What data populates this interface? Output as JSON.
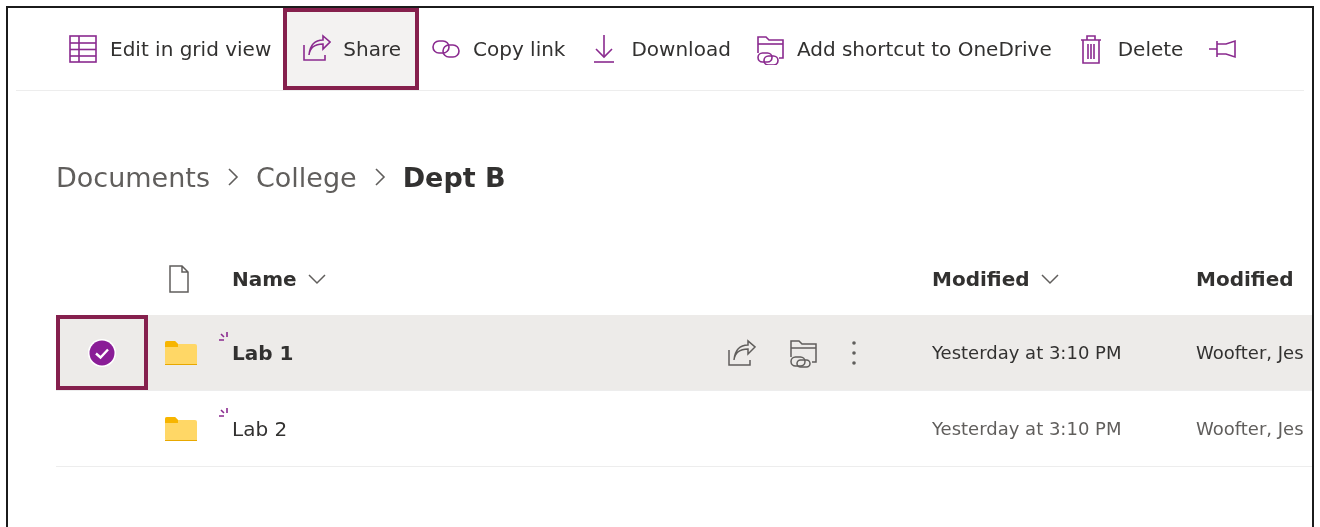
{
  "toolbar": [
    {
      "kind": "grid",
      "label": "Edit in grid view",
      "highlighted": false
    },
    {
      "kind": "share",
      "label": "Share",
      "highlighted": true
    },
    {
      "kind": "link",
      "label": "Copy link",
      "highlighted": false
    },
    {
      "kind": "download",
      "label": "Download",
      "highlighted": false
    },
    {
      "kind": "shortcut",
      "label": "Add shortcut to OneDrive",
      "highlighted": false
    },
    {
      "kind": "delete",
      "label": "Delete",
      "highlighted": false
    },
    {
      "kind": "pin",
      "highlighted": false
    }
  ],
  "breadcrumb": [
    "Documents",
    "College",
    "Dept B"
  ],
  "table": {
    "columns": [
      "Name",
      "Modified",
      "Modified"
    ],
    "rows": [
      {
        "name": "Lab 1",
        "modified": "Yesterday at 3:10 PM",
        "modified_by": "Woofter, Jes",
        "selected": true,
        "highlighted": true
      },
      {
        "name": "Lab 2",
        "modified": "Yesterday at 3:10 PM",
        "modified_by": "Woofter, Jes",
        "selected": false,
        "highlighted": false
      }
    ]
  }
}
